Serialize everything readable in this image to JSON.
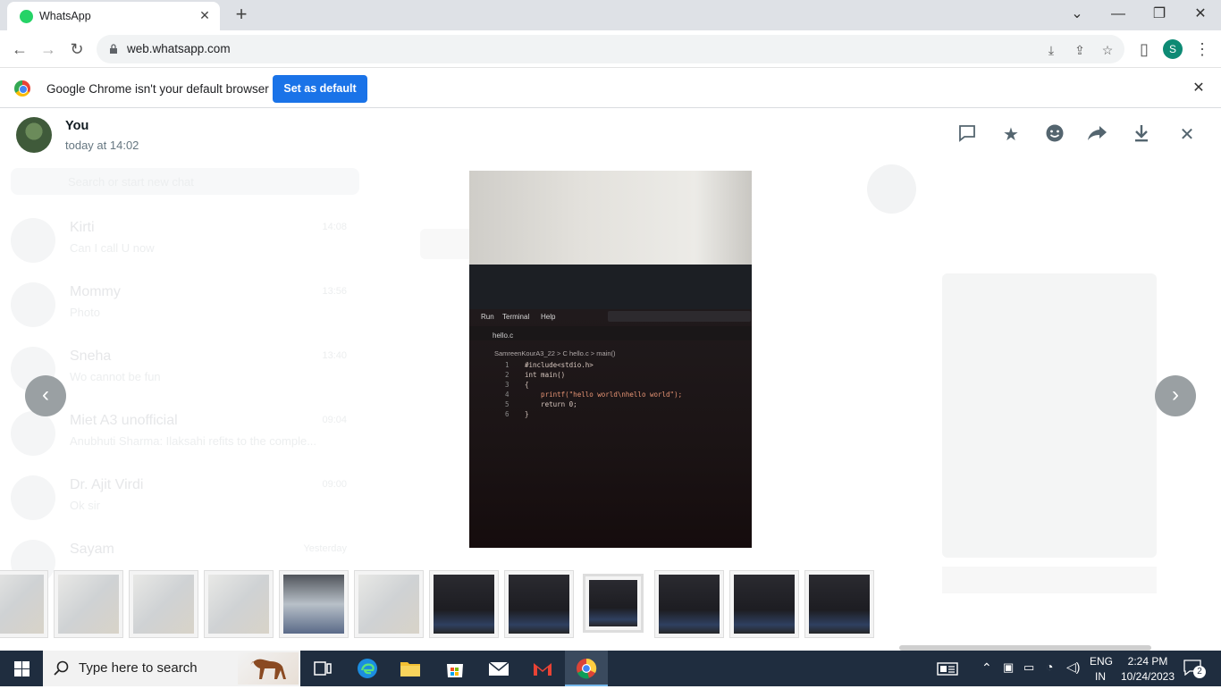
{
  "browser": {
    "tab_title": "WhatsApp",
    "url": "web.whatsapp.com",
    "profile_initial": "S"
  },
  "infobar": {
    "message": "Google Chrome isn't your default browser",
    "button": "Set as default"
  },
  "viewer": {
    "sender": "You",
    "timestamp": "today at 14:02"
  },
  "photo_code": {
    "menu": [
      "Run",
      "Terminal",
      "Help"
    ],
    "file_tab": "hello.c",
    "breadcrumb": "SamreenKourA3_22 > C hello.c > main()",
    "lines": [
      {
        "n": "1",
        "code": "#include<stdio.h>"
      },
      {
        "n": "2",
        "code": "int main()"
      },
      {
        "n": "3",
        "code": "{"
      },
      {
        "n": "4",
        "code": "    printf(\"hello world\\nhello world\");"
      },
      {
        "n": "5",
        "code": "    return 0;"
      },
      {
        "n": "6",
        "code": "}"
      }
    ]
  },
  "background_chats": [
    {
      "name": "Kirti",
      "msg": "Can I call U now",
      "time": "14:08"
    },
    {
      "name": "Mommy",
      "msg": "Photo",
      "time": "13:56"
    },
    {
      "name": "Sneha",
      "msg": "Wo cannot be fun",
      "time": "13:40"
    },
    {
      "name": "Miet A3 unofficial",
      "msg": "Anubhuti Sharma: Ilaksahi refits to the comple...",
      "time": "09:04"
    },
    {
      "name": "Dr. Ajit Virdi",
      "msg": "Ok sir",
      "time": "09:00"
    },
    {
      "name": "Sayam",
      "msg": "",
      "time": "Yesterday"
    }
  ],
  "background_search_placeholder": "Search or start new chat",
  "taskbar": {
    "search_placeholder": "Type here to search",
    "lang_top": "ENG",
    "lang_bottom": "IN",
    "time": "2:24 PM",
    "date": "10/24/2023",
    "notifications": "2"
  }
}
